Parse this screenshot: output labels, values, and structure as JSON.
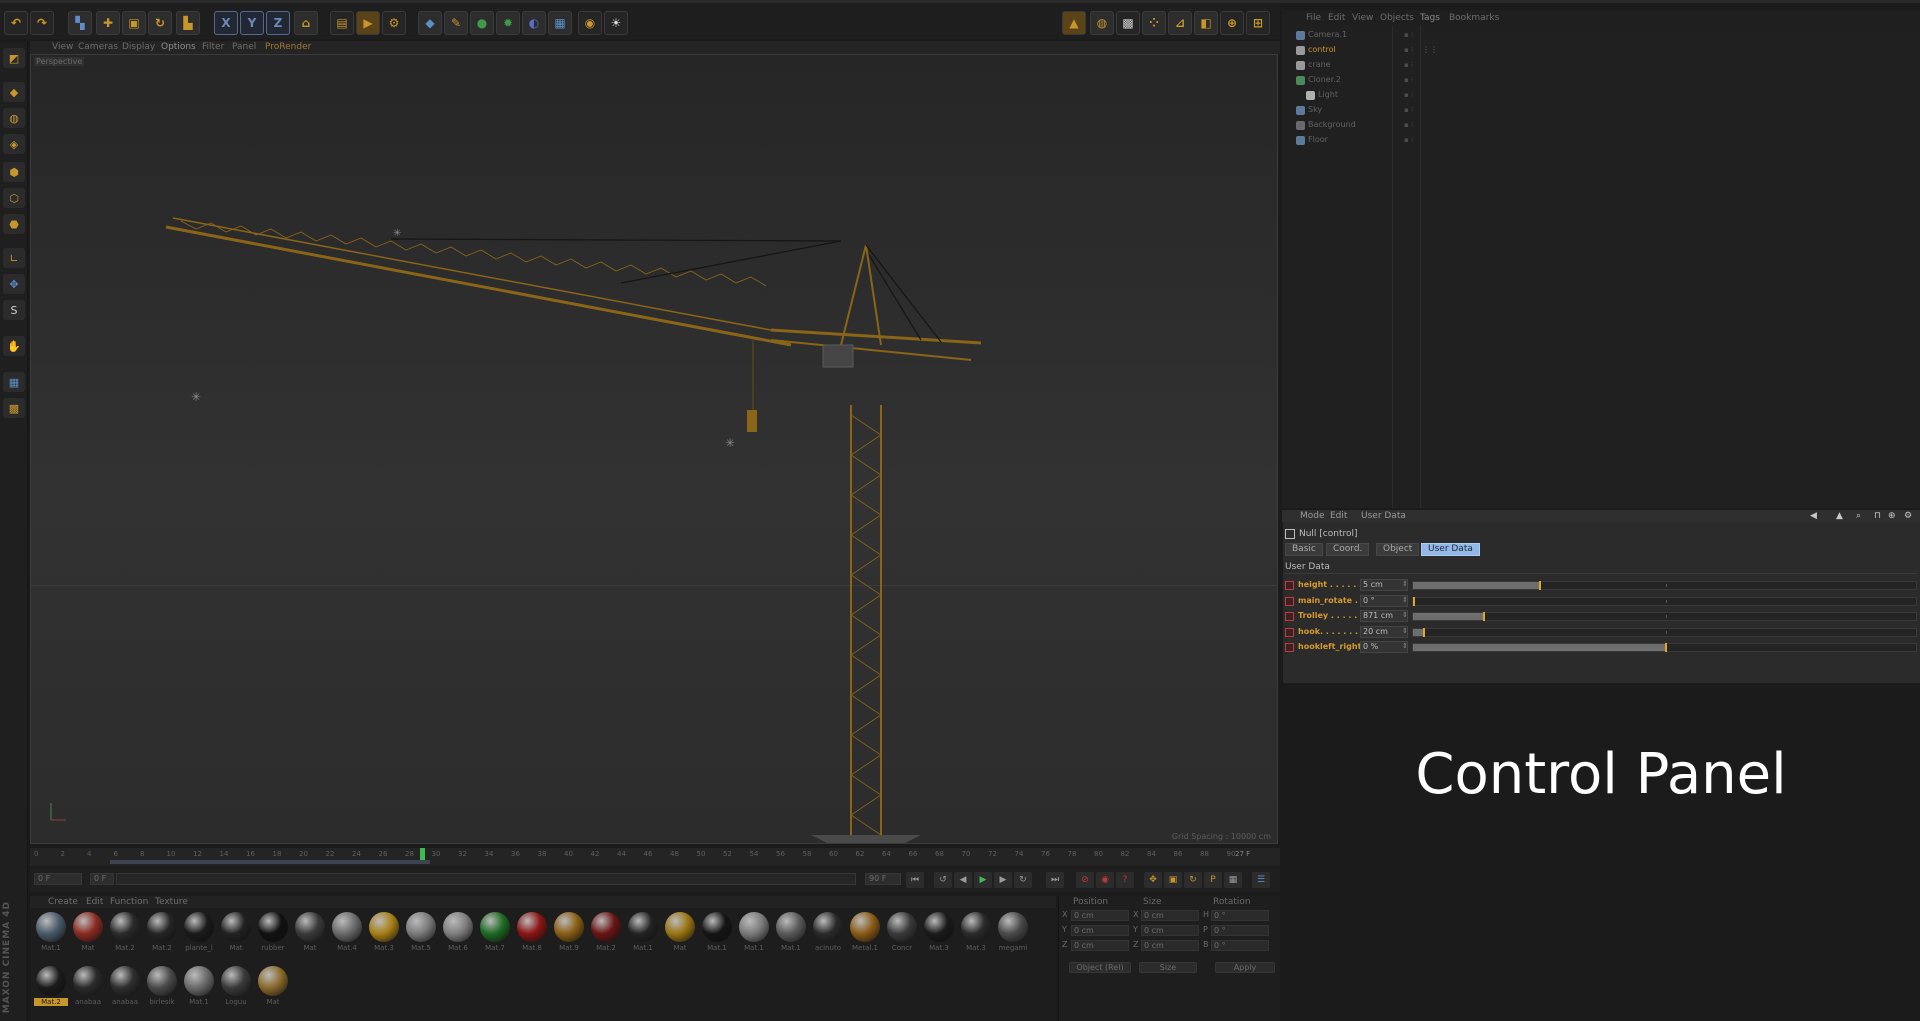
{
  "toolbar": {
    "axis_x": "X",
    "axis_y": "Y",
    "axis_z": "Z"
  },
  "viewport": {
    "menus": [
      "View",
      "Cameras",
      "Display",
      "Options",
      "Filter",
      "Panel",
      "ProRender"
    ],
    "label": "Perspective",
    "grid_spacing": "Grid Spacing : 10000 cm"
  },
  "timeline": {
    "ticks": [
      "0",
      "2",
      "4",
      "6",
      "8",
      "10",
      "12",
      "14",
      "16",
      "18",
      "20",
      "22",
      "24",
      "26",
      "28",
      "30",
      "32",
      "34",
      "36",
      "38",
      "40",
      "42",
      "44",
      "46",
      "48",
      "50",
      "52",
      "54",
      "56",
      "58",
      "60",
      "62",
      "64",
      "66",
      "68",
      "70",
      "72",
      "74",
      "76",
      "78",
      "80",
      "82",
      "84",
      "86",
      "88",
      "90"
    ],
    "current_frame_label": "27 F",
    "start_field": "0 F",
    "min_field": "0 F",
    "max_field": "90 F",
    "end_field": "90 F"
  },
  "materials": {
    "menus": [
      "Create",
      "Edit",
      "Function",
      "Texture"
    ],
    "items": [
      {
        "label": "Mat.1",
        "color": "#4a5a6a"
      },
      {
        "label": "Mat",
        "color": "#8a2a22"
      },
      {
        "label": "Mat.2",
        "color": "#2a2a2a"
      },
      {
        "label": "Mat.2",
        "color": "#252525"
      },
      {
        "label": "plante_l",
        "color": "#1a1a1a"
      },
      {
        "label": "Mat",
        "color": "#222222"
      },
      {
        "label": "rubber",
        "color": "#111111"
      },
      {
        "label": "Mat",
        "color": "#3a3a3a"
      },
      {
        "label": "Mat.4",
        "color": "#6a6a6a"
      },
      {
        "label": "Mat.3",
        "color": "#a67f14"
      },
      {
        "label": "Mat.5",
        "color": "#7a7a7a"
      },
      {
        "label": "Mat.6",
        "color": "#7e7e7e"
      },
      {
        "label": "Mat.7",
        "color": "#1e6a22"
      },
      {
        "label": "Mat.8",
        "color": "#8a1414"
      },
      {
        "label": "Mat.9",
        "color": "#8a5e14"
      },
      {
        "label": "Mat.2",
        "color": "#6a1414"
      },
      {
        "label": "Mat.1",
        "color": "#222222"
      },
      {
        "label": "Mat",
        "color": "#9a7412"
      },
      {
        "label": "Mat.1",
        "color": "#151515"
      },
      {
        "label": "Mat.1",
        "color": "#7a7a7a"
      },
      {
        "label": "Mat.1",
        "color": "#5a5a5a"
      },
      {
        "label": "acinuto",
        "color": "#2a2a2a"
      },
      {
        "label": "Metal.1",
        "color": "#8a5a14"
      },
      {
        "label": "Concr",
        "color": "#3a3a3a"
      },
      {
        "label": "Mat.3",
        "color": "#1a1a1a"
      },
      {
        "label": "Mat.3",
        "color": "#2a2a2a"
      },
      {
        "label": "megami",
        "color": "#4a4a4a"
      },
      {
        "label": "Mat.2",
        "color": "#1a1a1a",
        "selected": true
      },
      {
        "label": "anabaa",
        "color": "#2a2a2a"
      },
      {
        "label": "anabaa",
        "color": "#2e2e2e"
      },
      {
        "label": "birlesik",
        "color": "#4a4a4a"
      },
      {
        "label": "Mat.1",
        "color": "#6a6a6a"
      },
      {
        "label": "Loguu",
        "color": "#3a3a3a"
      },
      {
        "label": "Mat",
        "color": "#8a6a2a"
      }
    ]
  },
  "coordinates": {
    "headers": [
      "Position",
      "Size",
      "Rotation"
    ],
    "rows": [
      {
        "axis": "X",
        "pos": "0 cm",
        "size_axis": "X",
        "size": "0 cm",
        "rot_axis": "H",
        "rot": "0 °"
      },
      {
        "axis": "Y",
        "pos": "0 cm",
        "size_axis": "Y",
        "size": "0 cm",
        "rot_axis": "P",
        "rot": "0 °"
      },
      {
        "axis": "Z",
        "pos": "0 cm",
        "size_axis": "Z",
        "size": "0 cm",
        "rot_axis": "B",
        "rot": "0 °"
      }
    ],
    "mode": "Object (Rel)",
    "size_mode": "Size",
    "apply": "Apply"
  },
  "object_manager": {
    "menus": [
      "File",
      "Edit",
      "View",
      "Objects",
      "Tags",
      "Bookmarks"
    ],
    "objects": [
      {
        "name": "Camera.1",
        "indent": 0,
        "selected": false,
        "tag": ""
      },
      {
        "name": "control",
        "indent": 0,
        "selected": true,
        "tag": "⋮⋮"
      },
      {
        "name": "crane",
        "indent": 0,
        "selected": false,
        "tag": ""
      },
      {
        "name": "Cloner.2",
        "indent": 0,
        "selected": false,
        "tag": ""
      },
      {
        "name": "Light",
        "indent": 1,
        "selected": false,
        "tag": ""
      },
      {
        "name": "Sky",
        "indent": 0,
        "selected": false,
        "tag": ""
      },
      {
        "name": "Background",
        "indent": 0,
        "selected": false,
        "tag": ""
      },
      {
        "name": "Floor",
        "indent": 0,
        "selected": false,
        "tag": ""
      }
    ]
  },
  "attributes": {
    "menus": [
      "Mode",
      "Edit",
      "User Data"
    ],
    "title": "Null [control]",
    "tabs": [
      {
        "label": "Basic",
        "active": false
      },
      {
        "label": "Coord.",
        "active": false
      },
      {
        "label": "Object",
        "active": false
      },
      {
        "label": "User Data",
        "active": true
      }
    ],
    "section": "User Data",
    "user_data": [
      {
        "label": "height . . . . . . .",
        "value": "5 cm",
        "fraction": 0.25
      },
      {
        "label": "main_rotate . . .",
        "value": "0 °",
        "fraction": 0.0
      },
      {
        "label": "Trolley . . . . . .",
        "value": "871 cm",
        "fraction": 0.14
      },
      {
        "label": "hook. . . . . . . . .",
        "value": "20 cm",
        "fraction": 0.02
      },
      {
        "label": "hookleft_right",
        "value": "0 %",
        "fraction": 0.5
      }
    ]
  },
  "caption": "Control Panel",
  "branding": "MAXON CINEMA 4D"
}
